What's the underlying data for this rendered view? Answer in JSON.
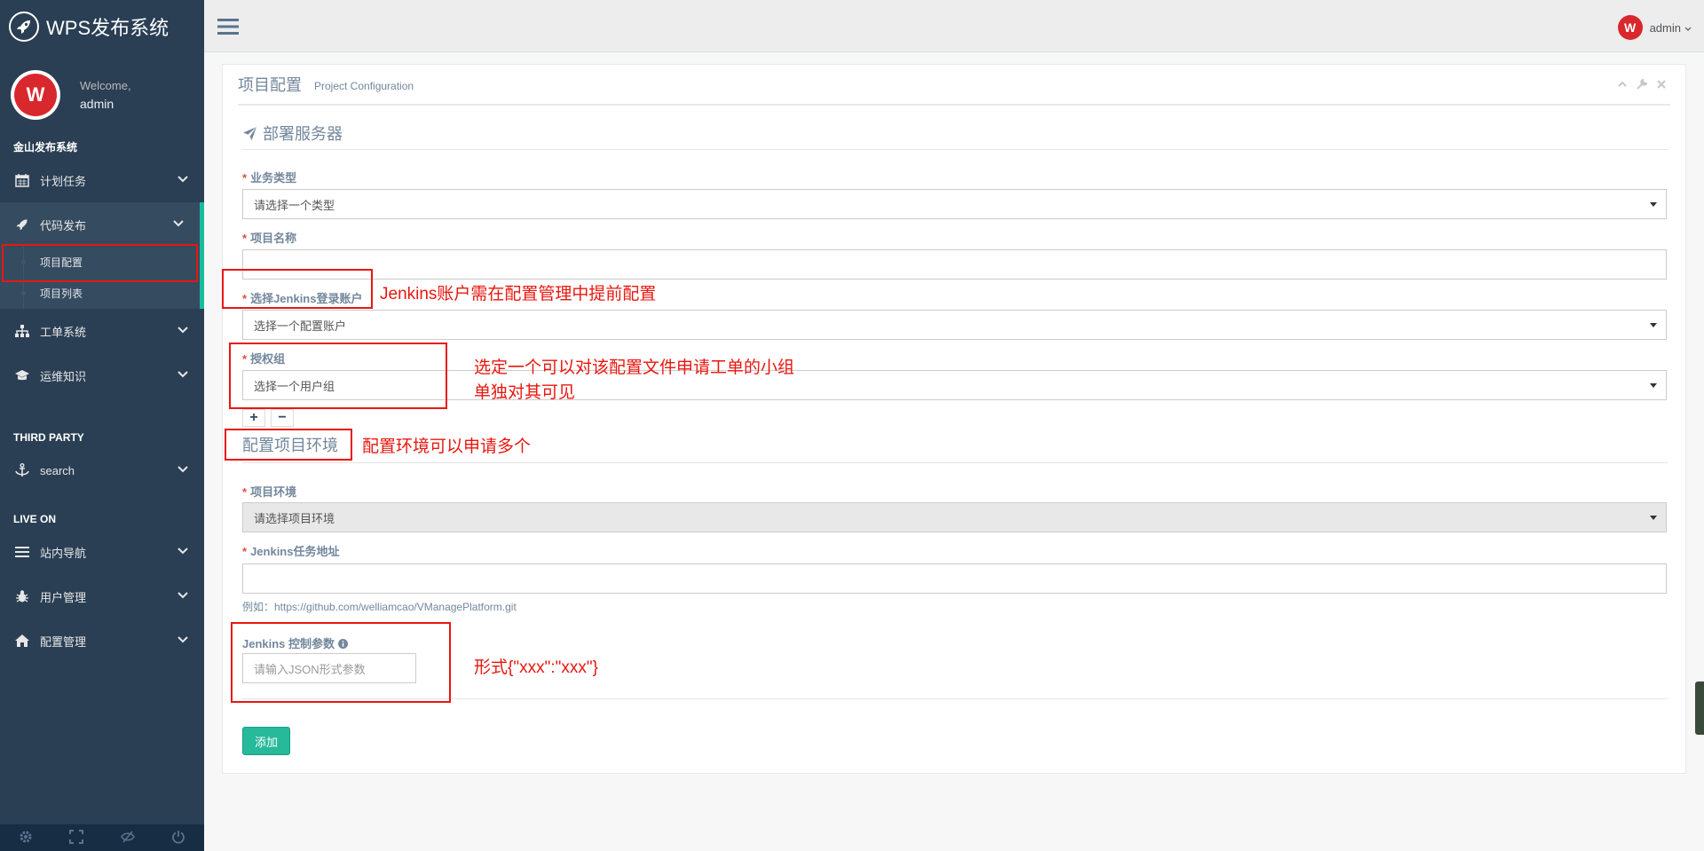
{
  "brand": {
    "title": "WPS发布系统",
    "icon": "rocket-icon"
  },
  "profile": {
    "welcome": "Welcome,",
    "name": "admin"
  },
  "sidebar": {
    "section1": "金山发布系统",
    "items": [
      {
        "label": "计划任务",
        "icon": "calendar-icon"
      },
      {
        "label": "代码发布",
        "icon": "rocket-icon"
      },
      {
        "label": "工单系统",
        "icon": "sitemap-icon"
      },
      {
        "label": "运维知识",
        "icon": "graduation-cap-icon"
      }
    ],
    "children": [
      {
        "label": "项目配置"
      },
      {
        "label": "项目列表"
      }
    ],
    "section2": "THIRD PARTY",
    "third": [
      {
        "label": "search",
        "icon": "anchor-icon"
      }
    ],
    "section3": "LIVE ON",
    "live": [
      {
        "label": "站内导航",
        "icon": "bars-icon"
      },
      {
        "label": "用户管理",
        "icon": "bug-icon"
      },
      {
        "label": "配置管理",
        "icon": "home-icon"
      }
    ],
    "footer_icons": [
      "gear-icon",
      "fullscreen-icon",
      "eye-slash-icon",
      "power-icon"
    ]
  },
  "topbar": {
    "user": "admin"
  },
  "panel": {
    "title": "项目配置",
    "subtitle": "Project Configuration",
    "deploy_section": "部署服务器",
    "fields": {
      "biz_type": {
        "label": "业务类型",
        "value": "请选择一个类型"
      },
      "project_name": {
        "label": "项目名称",
        "value": ""
      },
      "jenkins_account": {
        "label": "选择Jenkins登录账户",
        "value": "选择一个配置账户"
      },
      "auth_group": {
        "label": "授权组",
        "value": "选择一个用户组"
      },
      "env_section": "配置项目环境",
      "project_env": {
        "label": "项目环境",
        "value": "请选择项目环境"
      },
      "jenkins_url": {
        "label": "Jenkins任务地址",
        "value": "",
        "hint": "例如：https://github.com/welliamcao/VManagePlatform.git"
      },
      "jenkins_params": {
        "label": "Jenkins 控制参数",
        "placeholder": "请输入JSON形式参数"
      }
    },
    "add_button": "添加"
  },
  "annotations": {
    "jenkins_note": "Jenkins账户需在配置管理中提前配置",
    "group_note_line1": "选定一个可以对该配置文件申请工单的小组",
    "group_note_line2": "单独对其可见",
    "env_note": "配置环境可以申请多个",
    "json_note": "形式{\"xxx\":\"xxx\"}",
    "color": "#E8170F"
  },
  "colors": {
    "sidebar": "#2A3F54",
    "accent": "#1ABB9C",
    "add_button": "#26B99A",
    "required": "#E74C3C"
  }
}
